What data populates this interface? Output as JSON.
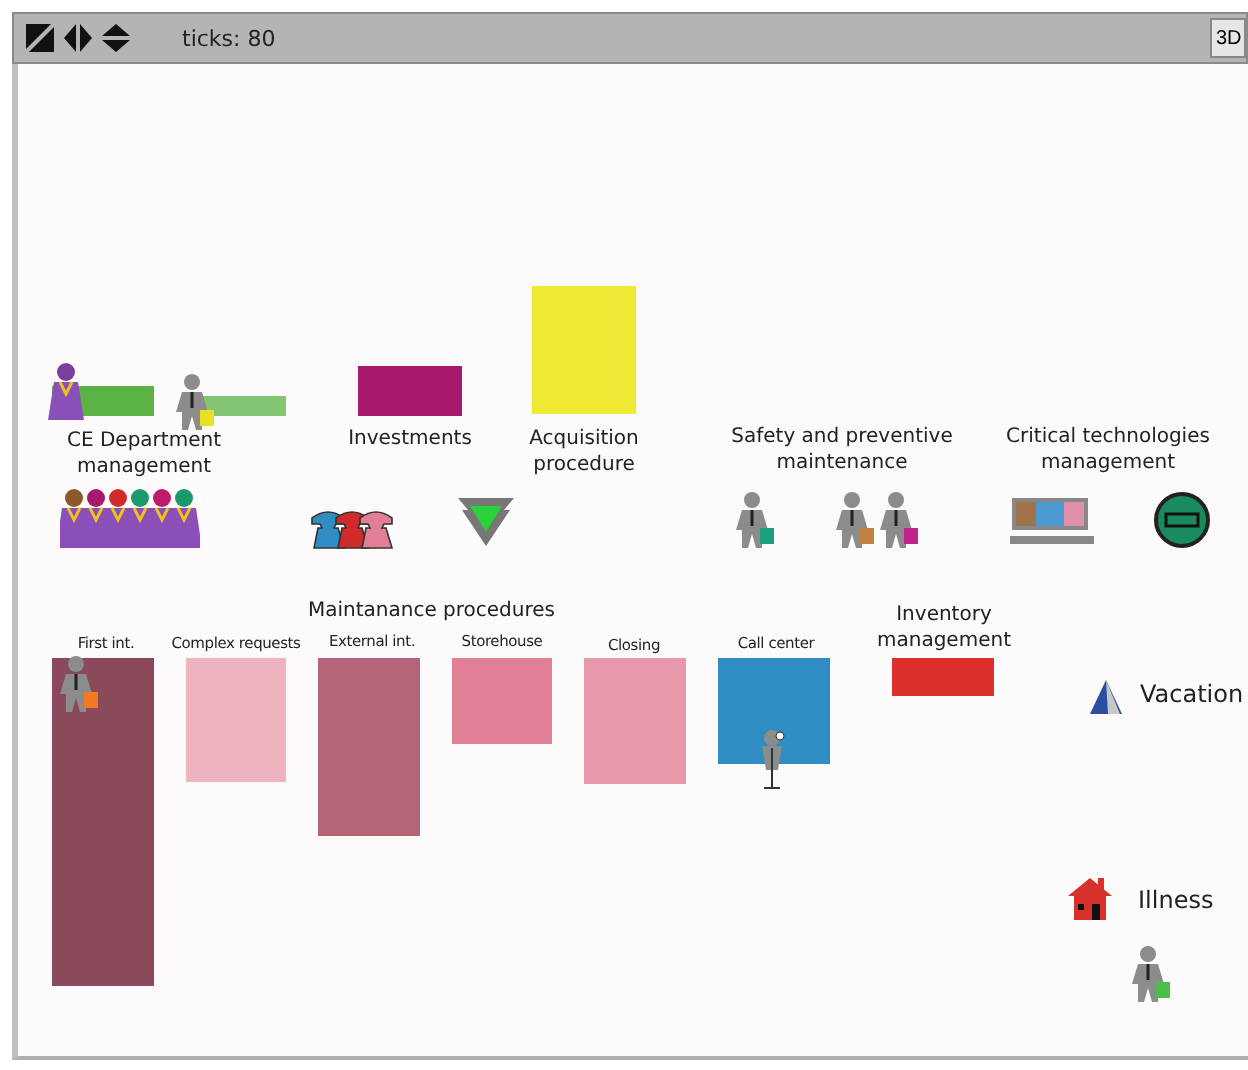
{
  "toolbar": {
    "ticks": "ticks: 80",
    "view_button": "3D"
  },
  "areas": [
    {
      "kind": "patch",
      "label": "CE Department management",
      "color": "#5bb345"
    },
    {
      "kind": "patch",
      "label": "Investments",
      "color": "#a8196b"
    },
    {
      "kind": "patch",
      "label": "Acquisition procedure",
      "color": "#eeea35"
    },
    {
      "kind": "label",
      "label": "Safety and preventive maintenance"
    },
    {
      "kind": "label",
      "label": "Critical technologies management"
    },
    {
      "kind": "patch",
      "label": "First int.",
      "color": "#8b4a5c"
    },
    {
      "kind": "patch",
      "label": "Complex requests",
      "color": "#efb3c0"
    },
    {
      "kind": "patch",
      "label": "External int.",
      "color": "#b46578"
    },
    {
      "kind": "patch",
      "label": "Storehouse",
      "color": "#e07f96"
    },
    {
      "kind": "patch",
      "label": "Closing",
      "color": "#e898aa"
    },
    {
      "kind": "patch",
      "label": "Call center",
      "color": "#2f8dc4"
    },
    {
      "kind": "patch",
      "label": "Inventory management",
      "color": "#dc302a"
    }
  ],
  "heading": "Maintanance procedures",
  "legend": [
    {
      "kind": "vacation",
      "label": "Vacation"
    },
    {
      "kind": "illness",
      "label": "Illness"
    }
  ]
}
